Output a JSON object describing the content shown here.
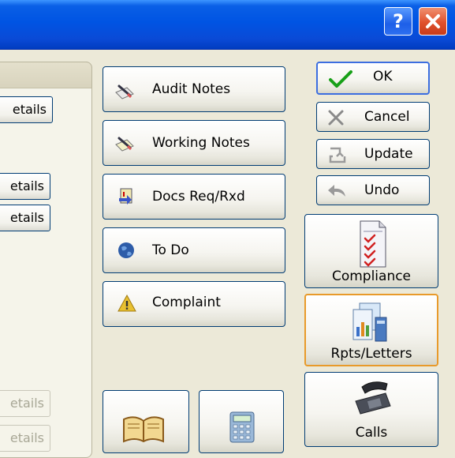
{
  "window": {
    "help_label": "?"
  },
  "left_panel": {
    "details_buttons": [
      "etails",
      "etails",
      "etails",
      "etails",
      "etails"
    ]
  },
  "notes_buttons": [
    {
      "label": "Audit Notes",
      "icon": "pen-notepad-icon"
    },
    {
      "label": "Working Notes",
      "icon": "pen-notepad-icon"
    },
    {
      "label": "Docs Req/Rxd",
      "icon": "docs-exchange-icon"
    },
    {
      "label": "To Do",
      "icon": "globe-icon"
    },
    {
      "label": "Complaint",
      "icon": "warning-icon"
    }
  ],
  "dialog_buttons": {
    "ok": "OK",
    "cancel": "Cancel",
    "update": "Update",
    "undo": "Undo"
  },
  "side_buttons": {
    "compliance": "Compliance",
    "rpts_letters": "Rpts/Letters",
    "calls": "Calls"
  },
  "colors": {
    "title_bar": "#0054e3",
    "button_border": "#003c74",
    "hot_border": "#e89a2a",
    "background": "#ece9d8"
  }
}
